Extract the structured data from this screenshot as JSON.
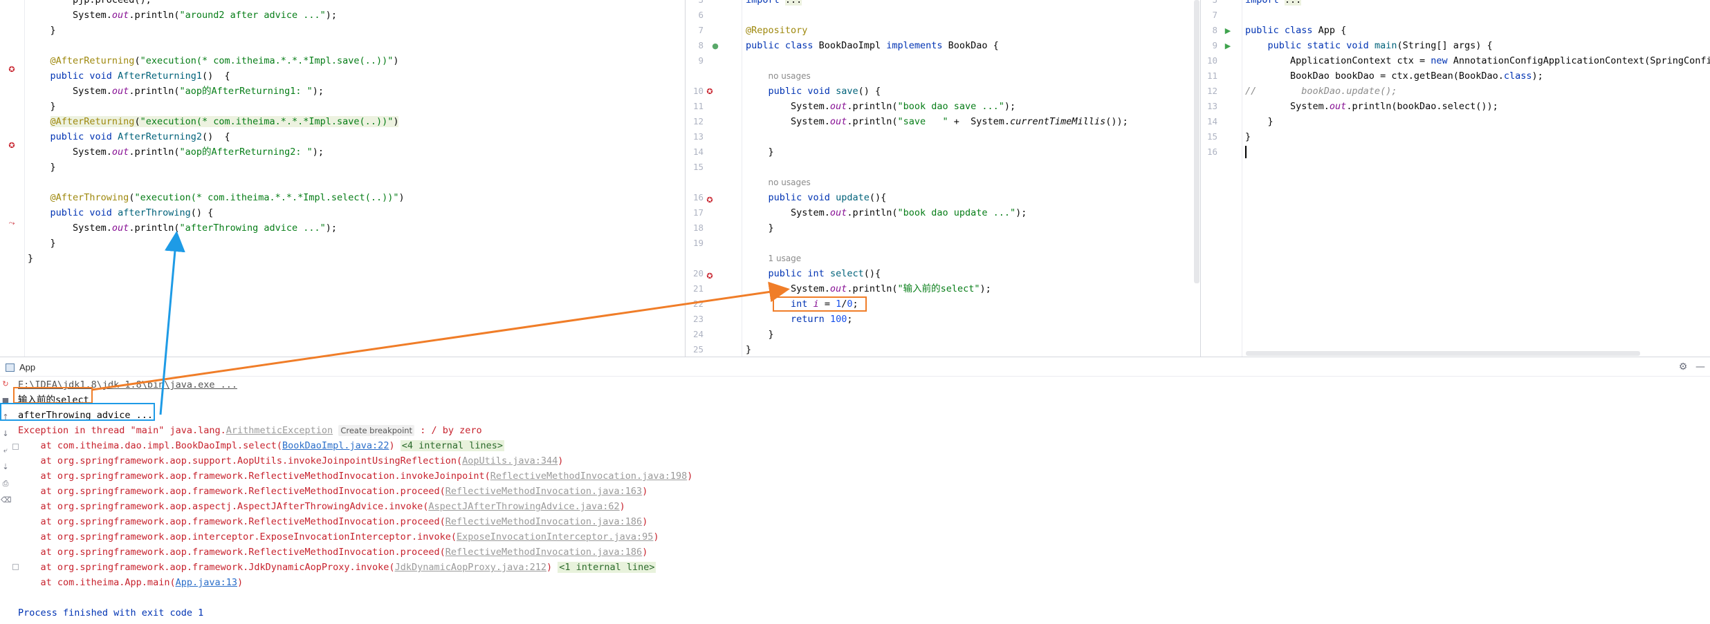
{
  "editor1": {
    "lines": [
      {
        "n": "",
        "html": "        pjp.proceed();"
      },
      {
        "n": "",
        "html": "        System.<span class=\"fld\">out</span>.println(<span class=\"str\">\"around2 after advice ...\"</span>);"
      },
      {
        "n": "",
        "html": "    }"
      },
      {
        "n": "",
        "html": ""
      },
      {
        "n": "",
        "html": "    <span class=\"ann\">@AfterReturning</span>(<span class=\"str\">\"execution(* com.itheima.*.*.*Impl.save(..))\"</span>)"
      },
      {
        "n": "",
        "html": "    <span class=\"kw\">public void</span> <span class=\"mth\">AfterReturning1</span>()  {"
      },
      {
        "n": "",
        "html": "        System.<span class=\"fld\">out</span>.println(<span class=\"str\">\"aop的AfterReturning1: \"</span>);"
      },
      {
        "n": "",
        "html": "    }"
      },
      {
        "n": "",
        "html": "    <span class=\"ann hl-ann\">@AfterReturning</span><span class=\"hl-ann\">(<span class=\"str\">\"execution(* com.itheima.*.*.*Impl.save(..))\"</span>)</span>"
      },
      {
        "n": "",
        "html": "    <span class=\"kw\">public void</span> <span class=\"mth\">AfterReturning2</span>()  {"
      },
      {
        "n": "",
        "html": "        System.<span class=\"fld\">out</span>.println(<span class=\"str\">\"aop的AfterReturning2: \"</span>);"
      },
      {
        "n": "",
        "html": "    }"
      },
      {
        "n": "",
        "html": ""
      },
      {
        "n": "",
        "html": "    <span class=\"ann\">@AfterThrowing</span>(<span class=\"str\">\"execution(* com.itheima.*.*.*Impl.select(..))\"</span>)"
      },
      {
        "n": "",
        "html": "    <span class=\"kw\">public void</span> <span class=\"mth\">afterThrowing</span>() {"
      },
      {
        "n": "",
        "html": "        System.<span class=\"fld\">out</span>.println(<span class=\"str\">\"afterThrowing advice ...\"</span>);"
      },
      {
        "n": "",
        "html": "    }"
      },
      {
        "n": "",
        "html": "}"
      }
    ]
  },
  "editor2": {
    "lines": [
      {
        "n": "3",
        "html": "<span class=\"kw\">import</span> <span class=\"hl-ann\">...</span>"
      },
      {
        "n": "6",
        "html": ""
      },
      {
        "n": "7",
        "html": "<span class=\"ann\">@Repository</span>"
      },
      {
        "n": "8",
        "html": "<span class=\"kw\">public class</span> BookDaoImpl <span class=\"kw\">implements</span> BookDao {"
      },
      {
        "n": "9",
        "html": ""
      },
      {
        "n": "",
        "html": "    <span class=\"hint\">no usages</span>"
      },
      {
        "n": "10",
        "html": "    <span class=\"kw\">public void</span> <span class=\"mth\">save</span>() {"
      },
      {
        "n": "11",
        "html": "        System.<span class=\"fld\">out</span>.println(<span class=\"str\">\"book dao save ...\"</span>);"
      },
      {
        "n": "12",
        "html": "        System.<span class=\"fld\">out</span>.println(<span class=\"str\">\"save   \"</span> +  System.<span class=\"stat\">currentTimeMillis</span>());"
      },
      {
        "n": "13",
        "html": ""
      },
      {
        "n": "14",
        "html": "    }"
      },
      {
        "n": "15",
        "html": ""
      },
      {
        "n": "",
        "html": "    <span class=\"hint\">no usages</span>"
      },
      {
        "n": "16",
        "html": "    <span class=\"kw\">public void</span> <span class=\"mth\">update</span>(){"
      },
      {
        "n": "17",
        "html": "        System.<span class=\"fld\">out</span>.println(<span class=\"str\">\"book dao update ...\"</span>);"
      },
      {
        "n": "18",
        "html": "    }"
      },
      {
        "n": "19",
        "html": ""
      },
      {
        "n": "",
        "html": "    <span class=\"hint\">1 usage</span>"
      },
      {
        "n": "20",
        "html": "    <span class=\"kw\">public int</span> <span class=\"mth\">select</span>(){"
      },
      {
        "n": "21",
        "html": "        System.<span class=\"fld\">out</span>.println(<span class=\"str\">\"输入前的select\"</span>);"
      },
      {
        "n": "22",
        "html": "        <span class=\"kw\">int</span> <span class=\"fld\">i</span> = <span class=\"num\">1</span>/<span class=\"num\">0</span>;"
      },
      {
        "n": "23",
        "html": "        <span class=\"kw\">return</span> <span class=\"num\">100</span>;"
      },
      {
        "n": "24",
        "html": "    }"
      },
      {
        "n": "25",
        "html": "}"
      }
    ]
  },
  "editor3": {
    "lines": [
      {
        "n": "3",
        "html": "<span class=\"kw\">import</span> <span class=\"hl-ann\">...</span>"
      },
      {
        "n": "7",
        "html": ""
      },
      {
        "n": "8",
        "html": "<span class=\"kw\">public class</span> App {"
      },
      {
        "n": "9",
        "html": "    <span class=\"kw\">public static void</span> <span class=\"mth\">main</span>(String[] args) {"
      },
      {
        "n": "10",
        "html": "        ApplicationContext ctx = <span class=\"kw\">new</span> AnnotationConfigApplicationContext(SpringConfig.<span class=\"kw\">class</span>);"
      },
      {
        "n": "11",
        "html": "        BookDao bookDao = ctx.getBean(BookDao.<span class=\"kw\">class</span>);"
      },
      {
        "n": "12",
        "html": "<span class=\"cmt\">//        bookDao.update();</span>"
      },
      {
        "n": "13",
        "html": "        System.<span class=\"fld\">out</span>.println(bookDao.select());"
      },
      {
        "n": "14",
        "html": "    }"
      },
      {
        "n": "15",
        "html": "}"
      },
      {
        "n": "16",
        "html": "<span class=\"cur\"></span>"
      }
    ]
  },
  "run_panel": {
    "tab_label": "App",
    "gear_glyph": "⚙",
    "minimize_glyph": "—",
    "lines": [
      {
        "html": "<span class=\"lnk\" style=\"color:#555\">E:\\IDEA\\jdk1.8\\jdk-1.8\\bin\\java.exe ...</span>"
      },
      {
        "html": "输入前的select"
      },
      {
        "html": "afterThrowing advice ..."
      },
      {
        "html": "<span class=\"err\">Exception in thread \"main\" java.lang.</span><span class=\"glink\">ArithmeticException</span> <span class=\"bp\">Create breakpoint</span><span class=\"err\"> : / by zero</span>"
      },
      {
        "html": "<span class=\"err\">    at com.itheima.dao.impl.BookDaoImpl.select(</span><span class=\"lnk\">BookDaoImpl.java:22</span><span class=\"err\">)</span> <span class=\"inl\">&lt;4 internal lines&gt;</span>"
      },
      {
        "html": "<span class=\"err\">    at org.springframework.aop.support.AopUtils.invokeJoinpointUsingReflection(</span><span class=\"glink\">AopUtils.java:344</span><span class=\"err\">)</span>"
      },
      {
        "html": "<span class=\"err\">    at org.springframework.aop.framework.ReflectiveMethodInvocation.invokeJoinpoint(</span><span class=\"glink\">ReflectiveMethodInvocation.java:198</span><span class=\"err\">)</span>"
      },
      {
        "html": "<span class=\"err\">    at org.springframework.aop.framework.ReflectiveMethodInvocation.proceed(</span><span class=\"glink\">ReflectiveMethodInvocation.java:163</span><span class=\"err\">)</span>"
      },
      {
        "html": "<span class=\"err\">    at org.springframework.aop.aspectj.AspectJAfterThrowingAdvice.invoke(</span><span class=\"glink\">AspectJAfterThrowingAdvice.java:62</span><span class=\"err\">)</span>"
      },
      {
        "html": "<span class=\"err\">    at org.springframework.aop.framework.ReflectiveMethodInvocation.proceed(</span><span class=\"glink\">ReflectiveMethodInvocation.java:186</span><span class=\"err\">)</span>"
      },
      {
        "html": "<span class=\"err\">    at org.springframework.aop.interceptor.ExposeInvocationInterceptor.invoke(</span><span class=\"glink\">ExposeInvocationInterceptor.java:95</span><span class=\"err\">)</span>"
      },
      {
        "html": "<span class=\"err\">    at org.springframework.aop.framework.ReflectiveMethodInvocation.proceed(</span><span class=\"glink\">ReflectiveMethodInvocation.java:186</span><span class=\"err\">)</span>"
      },
      {
        "html": "<span class=\"err\">    at org.springframework.aop.framework.JdkDynamicAopProxy.invoke(</span><span class=\"glink\">JdkDynamicAopProxy.java:212</span><span class=\"err\">)</span> <span class=\"inl\">&lt;1 internal line&gt;</span>"
      },
      {
        "html": "<span class=\"err\">    at com.itheima.App.main(</span><span class=\"lnk\">App.java:13</span><span class=\"err\">)</span>"
      },
      {
        "html": ""
      },
      {
        "html": "<span class=\"kw\" style=\"color:#0033b3\">Process finished with exit code 1</span>"
      }
    ]
  },
  "colors": {
    "arrow_blue": "#1e9be6",
    "arrow_orange": "#f07d28",
    "box_orange": "#f07d28",
    "box_blue": "#1e9be6"
  }
}
